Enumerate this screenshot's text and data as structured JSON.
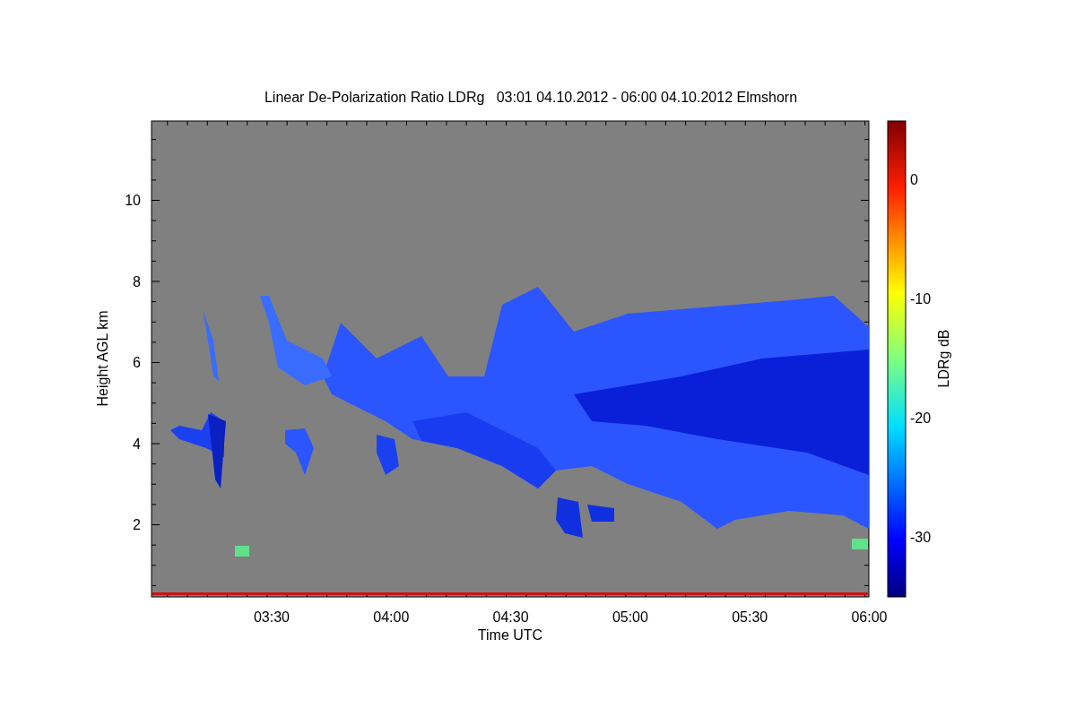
{
  "title": "Linear De-Polarization Ratio LDRg   03:01 04.10.2012 - 06:00 04.10.2012 Elmshorn",
  "y_axis": {
    "label": "Height AGL km",
    "ticks": [
      "10",
      "8",
      "6",
      "4",
      "2"
    ]
  },
  "x_axis": {
    "label": "Time UTC",
    "ticks": [
      "03:30",
      "04:00",
      "04:30",
      "05:00",
      "05:30",
      "06:00"
    ]
  },
  "colorbar": {
    "label": "LDRg dB",
    "ticks": [
      "0",
      "-10",
      "-20",
      "-30"
    ]
  }
}
